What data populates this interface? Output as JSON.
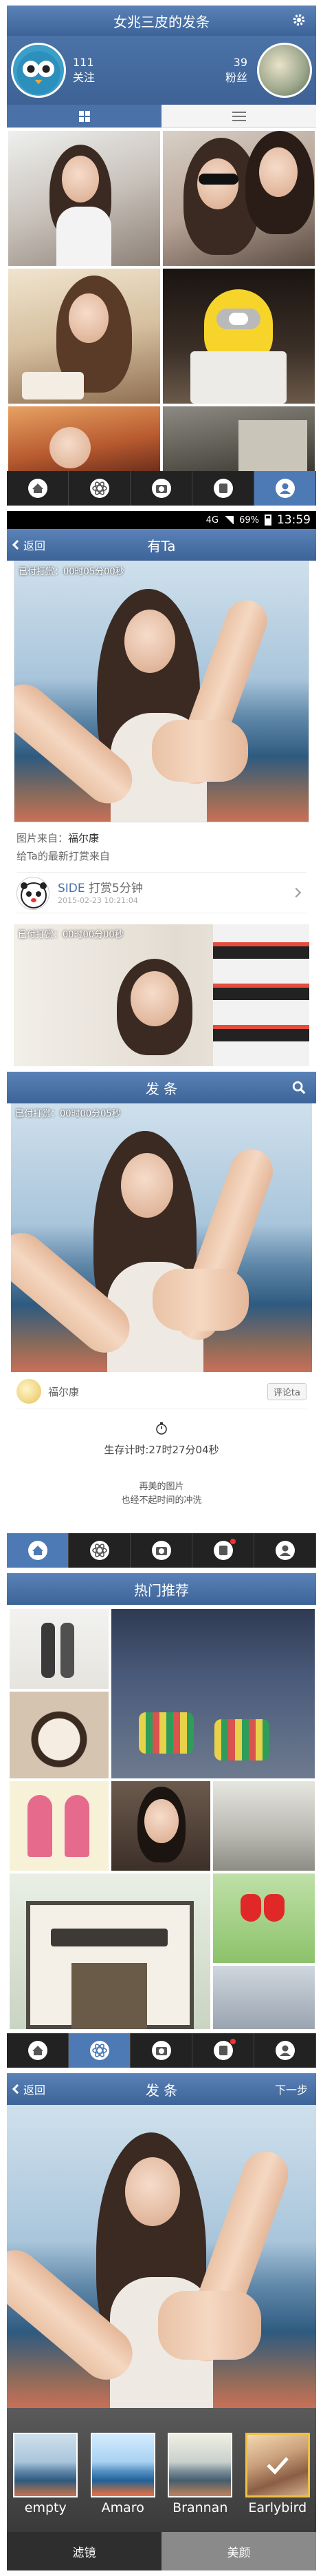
{
  "profile": {
    "title": "女兆三皮的发条",
    "following_count": "111",
    "following_label": "关注",
    "followers_count": "39",
    "followers_label": "粉丝"
  },
  "status_bar": {
    "network": "4G",
    "battery": "69%",
    "time": "13:59"
  },
  "detail": {
    "back_label": "返回",
    "title": "有Ta",
    "timer_overlay": "已付打赏：00时05分00秒",
    "source_label": "图片来自：",
    "source_user": "福尔康",
    "latest_tip": "给Ta的最新打赏来自",
    "tipper_name": "SIDE",
    "tip_action": "打赏5分钟",
    "tip_time": "2015-02-23 10:21:04",
    "second_overlay": "已付打赏：00时00分00秒"
  },
  "post": {
    "title": "发 条",
    "overlay": "已付打赏：00时00分05秒",
    "user": "福尔康",
    "comment_button": "评论ta",
    "timer_text": "生存计时:27时27分04秒",
    "caption_line1": "再美的图片",
    "caption_line2": "也经不起时间的冲洗"
  },
  "hot": {
    "title": "热门推荐"
  },
  "editor": {
    "back_label": "返回",
    "title": "发 条",
    "next_label": "下一步",
    "filters": [
      {
        "name": "empty"
      },
      {
        "name": "Amaro"
      },
      {
        "name": "Brannan"
      },
      {
        "name": "Earlybird"
      }
    ],
    "tab_filter": "滤镜",
    "tab_beauty": "美颜"
  },
  "colors": {
    "header_blue": "#4a72a8",
    "nav_active": "#4d7ab5",
    "badge_red": "#e33333"
  }
}
